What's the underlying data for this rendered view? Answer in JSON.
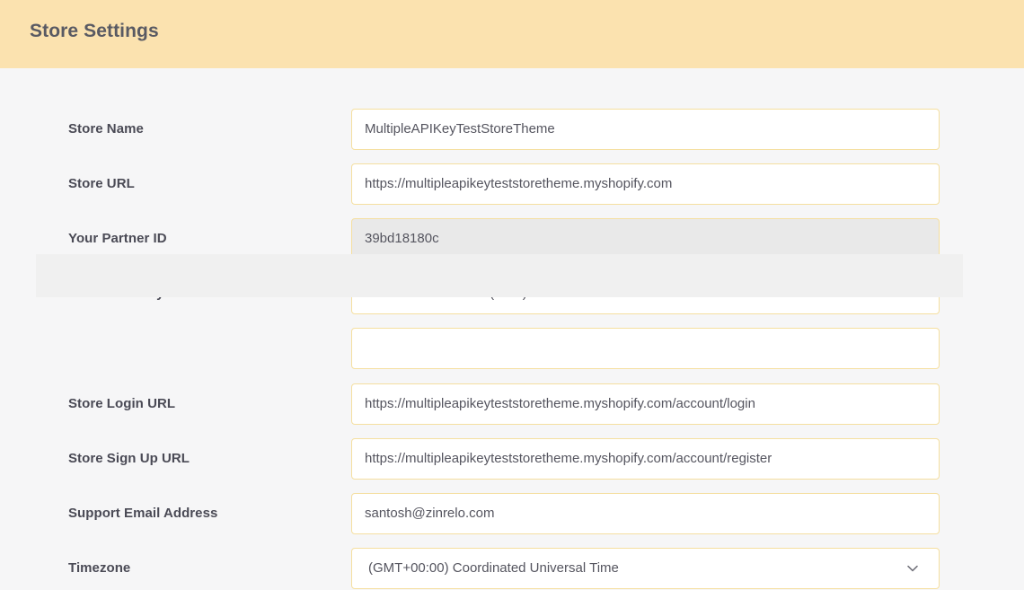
{
  "header": {
    "title": "Store Settings"
  },
  "form": {
    "fields": [
      {
        "label": "Store Name",
        "value": "MultipleAPIKeyTestStoreTheme",
        "type": "text"
      },
      {
        "label": "Store URL",
        "value": "https://multipleapikeyteststoretheme.myshopify.com",
        "type": "text"
      },
      {
        "label": "Your Partner ID",
        "value": "39bd18180c",
        "type": "text-disabled"
      },
      {
        "label": "Store currency",
        "value": "United States dollar (USD)",
        "type": "select",
        "icon": "chevron-down-icon"
      },
      {
        "label": "Store Login URL",
        "value": "https://multipleapikeyteststoretheme.myshopify.com/account/login",
        "type": "text"
      },
      {
        "label": "Store Sign Up URL",
        "value": "https://multipleapikeyteststoretheme.myshopify.com/account/register",
        "type": "text"
      },
      {
        "label": "Support Email Address",
        "value": "santosh@zinrelo.com",
        "type": "text"
      },
      {
        "label": "(GMT+00:00) Coordinated Universal Time",
        "value": "(GMT+00:00) Coordinated Universal Time",
        "type": "select",
        "icon": "chevron-down-icon"
      }
    ],
    "timezone_label": "Timezone"
  },
  "colors": {
    "header_background": "#fbe2af",
    "page_background": "#f6f6f7",
    "input_border": "#f5dfa0",
    "label_text": "#4a4a55",
    "value_text": "#55555f",
    "disabled_field": "#e9e9e9",
    "overlay_block": "#f0f0f0"
  }
}
